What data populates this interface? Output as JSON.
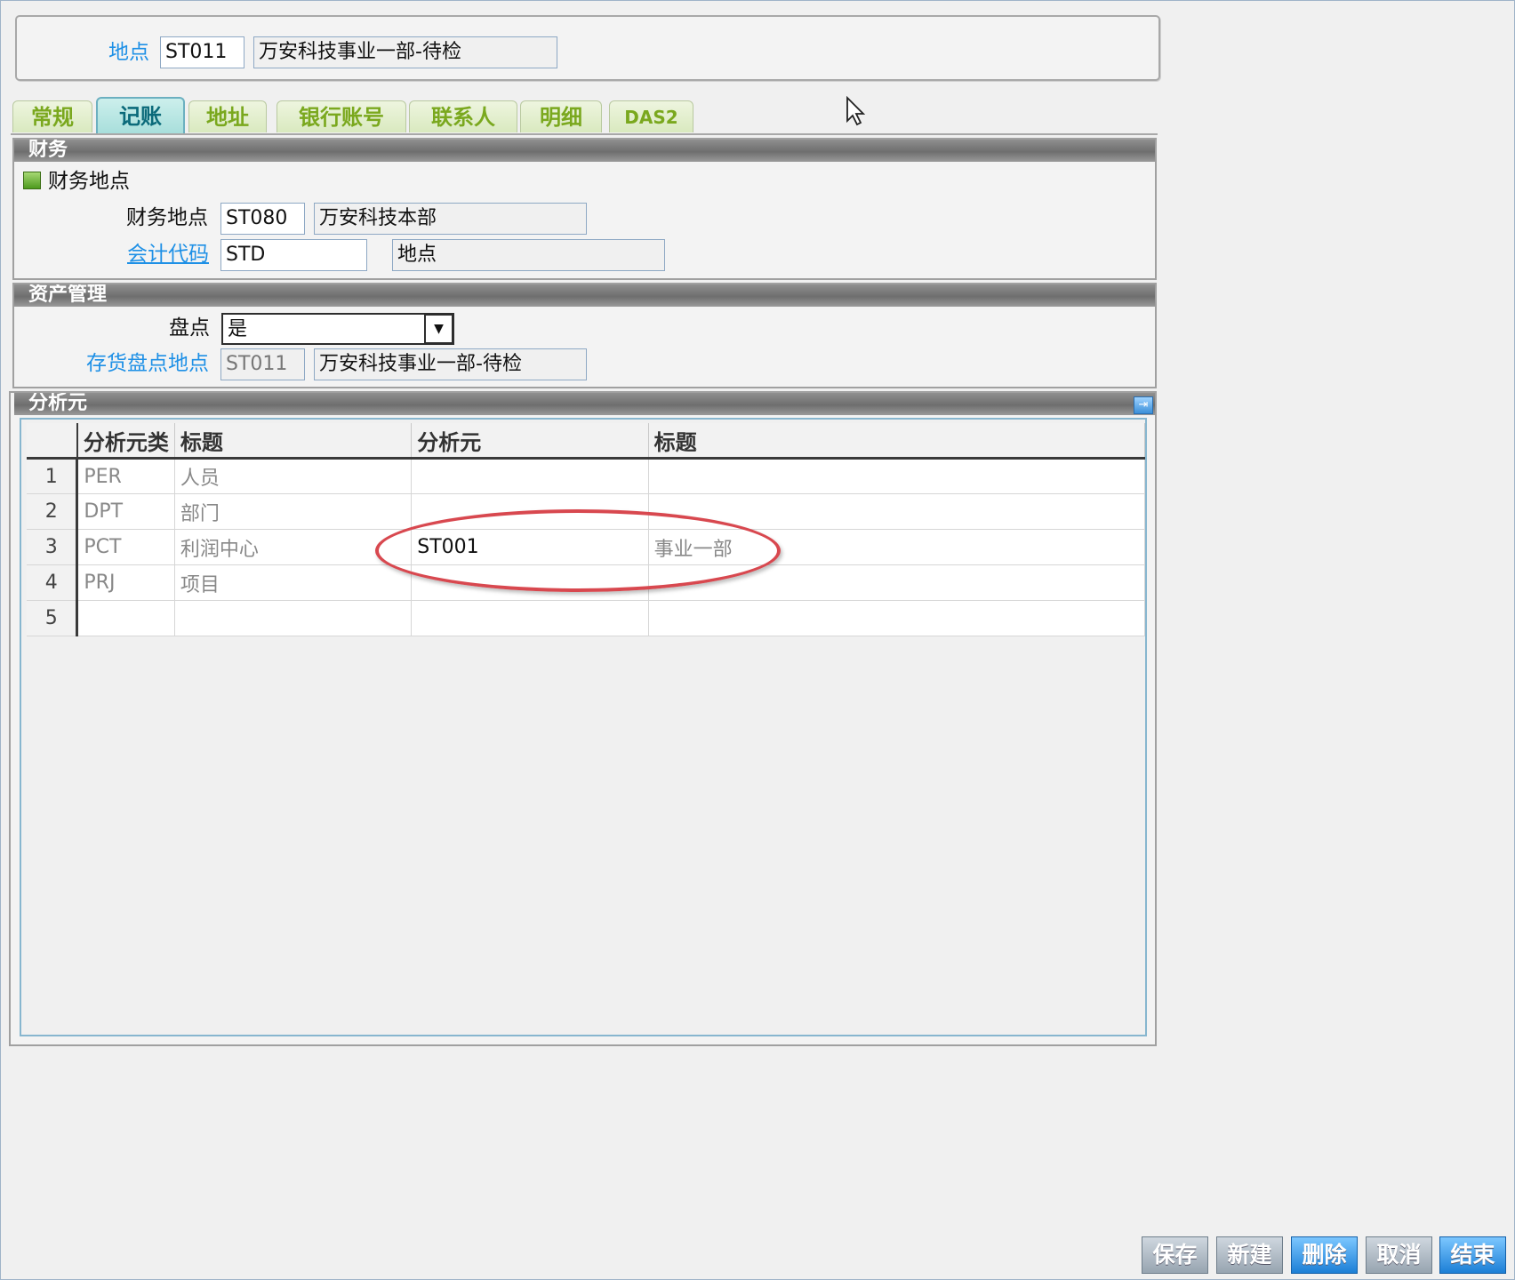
{
  "header": {
    "location_label": "地点",
    "location_code": "ST011",
    "location_name": "万安科技事业一部-待检"
  },
  "tabs": [
    "常规",
    "记账",
    "地址",
    "银行账号",
    "联系人",
    "明细",
    "DAS2"
  ],
  "active_tab": "记账",
  "finance": {
    "section_title": "财务",
    "group_title": "财务地点",
    "finance_location_label": "财务地点",
    "finance_location_code": "ST080",
    "finance_location_name": "万安科技本部",
    "accounting_code_label": "会计代码",
    "accounting_code": "STD",
    "accounting_code_desc": "地点"
  },
  "asset": {
    "section_title": "资产管理",
    "inventory_label": "盘点",
    "inventory_value": "是",
    "stock_location_label": "存货盘点地点",
    "stock_location_code": "ST011",
    "stock_location_name": "万安科技事业一部-待检"
  },
  "analysis": {
    "section_title": "分析元",
    "columns": [
      "分析元类",
      "标题",
      "分析元",
      "标题"
    ],
    "rows": [
      {
        "n": "1",
        "type": "PER",
        "title": "人员",
        "element": "",
        "element_title": ""
      },
      {
        "n": "2",
        "type": "DPT",
        "title": "部门",
        "element": "",
        "element_title": ""
      },
      {
        "n": "3",
        "type": "PCT",
        "title": "利润中心",
        "element": "ST001",
        "element_title": "事业一部"
      },
      {
        "n": "4",
        "type": "PRJ",
        "title": "项目",
        "element": "",
        "element_title": ""
      },
      {
        "n": "5",
        "type": "",
        "title": "",
        "element": "",
        "element_title": ""
      }
    ]
  },
  "footer": {
    "save": "保存",
    "new": "新建",
    "delete": "删除",
    "cancel": "取消",
    "finish": "结束"
  }
}
